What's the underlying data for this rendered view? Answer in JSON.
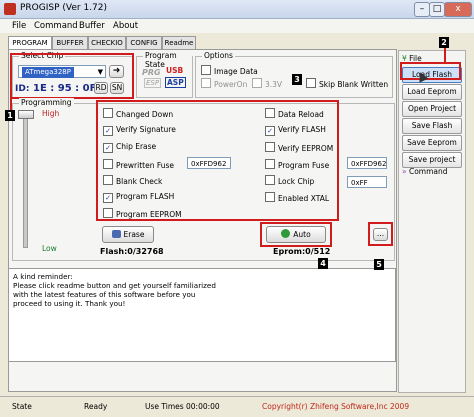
{
  "window": {
    "title": "PROGISP (Ver 1.72)",
    "min": "–",
    "max": "□",
    "close": "x"
  },
  "menu": [
    "File",
    "Command",
    "Buffer",
    "About"
  ],
  "tabs": [
    "PROGRAM",
    "BUFFER",
    "CHECKIO",
    "CONFIG",
    "Readme"
  ],
  "select_chip": {
    "title": "Select Chip",
    "chip": "ATmega328P",
    "id_label": "ID:",
    "id_value": "1E : 95 : 0F",
    "rd": "RD",
    "sn": "SN"
  },
  "program_state": {
    "title": "Program State",
    "prg": "PRG",
    "esp": "ESP",
    "usb": "USB",
    "asp": "ASP"
  },
  "options": {
    "title": "Options",
    "image_data": "Image Data",
    "power_on": "PowerOn",
    "voltage": "3.3V",
    "skip_blank": "Skip Blank Written"
  },
  "programming": {
    "title": "Programming",
    "high": "High",
    "low": "Low"
  },
  "ops_left": [
    {
      "label": "Changed Down",
      "checked": false
    },
    {
      "label": "Verify Signature",
      "checked": true
    },
    {
      "label": "Chip Erase",
      "checked": true
    },
    {
      "label": "Prewritten Fuse",
      "checked": false
    },
    {
      "label": "Blank Check",
      "checked": false
    },
    {
      "label": "Program FLASH",
      "checked": true
    },
    {
      "label": "Program EEPROM",
      "checked": false
    }
  ],
  "prewritten_fuse_value": "0xFFD962",
  "ops_right": [
    {
      "label": "Data Reload",
      "checked": false
    },
    {
      "label": "Verify FLASH",
      "checked": true
    },
    {
      "label": "Verify EEPROM",
      "checked": false
    },
    {
      "label": "Program Fuse",
      "checked": false
    },
    {
      "label": "Lock Chip",
      "checked": false
    },
    {
      "label": "Enabled XTAL",
      "checked": false
    }
  ],
  "fuse_value": "0xFFD962",
  "lock_value": "0xFF",
  "buttons": {
    "erase": "Erase",
    "auto": "Auto",
    "more": "..."
  },
  "flash_info": "Flash:0/32768",
  "eprom_info": "Eprom:0/512",
  "log": [
    "A kind reminder:",
    "Please click readme button and get yourself familiarized",
    "with the latest features of this software before you",
    "proceed to using it. Thank you!"
  ],
  "sidebar": {
    "file_header": "File",
    "items": [
      "Load Flash",
      "Load Eeprom",
      "Open Project",
      "Save Flash",
      "Save Eeprom",
      "Save project"
    ],
    "command_header": "Command"
  },
  "annotations": [
    "1",
    "2",
    "3",
    "4",
    "5"
  ],
  "status": {
    "state_label": "State",
    "state_value": "Ready",
    "use_times_label": "Use Times",
    "use_times_value": "00:00:00",
    "copyright": "Copyright(r) Zhifeng Software,Inc 2009"
  },
  "colors": {
    "annotation_red": "#d01c1c",
    "copyright": "#c0281c",
    "chip_highlight": "#3163c5"
  }
}
